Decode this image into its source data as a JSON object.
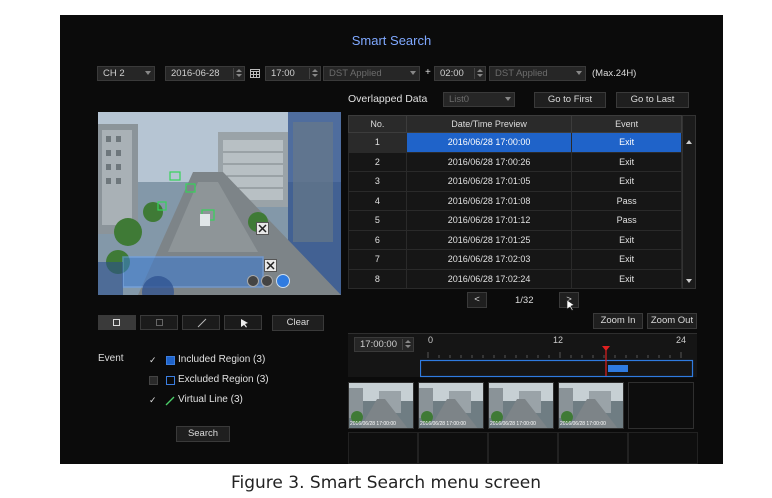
{
  "title": "Smart Search",
  "toolbar": {
    "channel": "CH 2",
    "date": "2016-06-28",
    "time": "17:00",
    "dst_left": "DST Applied",
    "plus": "+",
    "duration": "02:00",
    "dst_right": "DST Applied",
    "max_note": "(Max.24H)"
  },
  "overlap": {
    "label": "Overlapped Data",
    "list_value": "List0",
    "go_first": "Go to First",
    "go_last": "Go to Last"
  },
  "table": {
    "headers": [
      "No.",
      "Date/Time Preview",
      "Event"
    ],
    "rows": [
      {
        "no": "1",
        "datetime": "2016/06/28 17:00:00",
        "event": "Exit"
      },
      {
        "no": "2",
        "datetime": "2016/06/28 17:00:26",
        "event": "Exit"
      },
      {
        "no": "3",
        "datetime": "2016/06/28 17:01:05",
        "event": "Exit"
      },
      {
        "no": "4",
        "datetime": "2016/06/28 17:01:08",
        "event": "Pass"
      },
      {
        "no": "5",
        "datetime": "2016/06/28 17:01:12",
        "event": "Pass"
      },
      {
        "no": "6",
        "datetime": "2016/06/28 17:01:25",
        "event": "Exit"
      },
      {
        "no": "7",
        "datetime": "2016/06/28 17:02:03",
        "event": "Exit"
      },
      {
        "no": "8",
        "datetime": "2016/06/28 17:02:24",
        "event": "Exit"
      }
    ],
    "selected_row": 1
  },
  "pager": {
    "prev": "<",
    "page": "1/32",
    "next": ">"
  },
  "zoom": {
    "in": "Zoom In",
    "out": "Zoom Out"
  },
  "timeline": {
    "time": "17:00:00",
    "tick_0": "0",
    "tick_12": "12",
    "tick_24": "24"
  },
  "tools": {
    "clear": "Clear"
  },
  "event": {
    "label": "Event",
    "included": "Included Region (3)",
    "excluded": "Excluded Region (3)",
    "virtual": "Virtual Line (3)",
    "search": "Search"
  },
  "thumb_label": "2016/06/28 17:00:00",
  "caption": "Figure 3. Smart Search menu screen",
  "colors": {
    "accent": "#1f63c9",
    "title": "#7fa8ff",
    "marker": "#e02020"
  }
}
